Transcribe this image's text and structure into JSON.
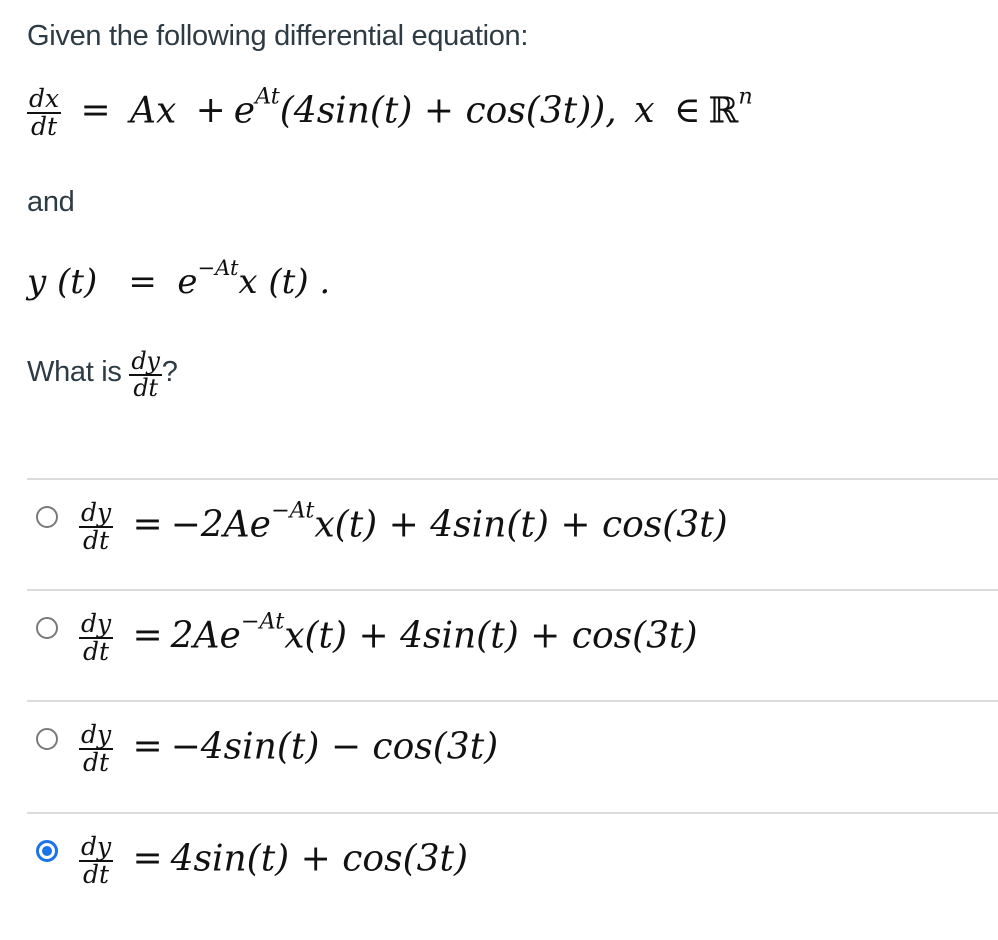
{
  "question": {
    "intro": "Given the following differential equation:",
    "equation1": {
      "lhs_num": "dx",
      "lhs_den": "dt",
      "equals": "=",
      "term1": "Ax",
      "plus": "+",
      "exp_base": "e",
      "exp_power": "At",
      "paren_content": "(4sin(t) + cos(3t)),",
      "domain_var": "x",
      "in_symbol": "∈",
      "set": "ℝ",
      "set_power": "n"
    },
    "connector": "and",
    "equation2": {
      "lhs": "y (t)",
      "equals": "=",
      "exp_base": "e",
      "exp_power": "−At",
      "rhs": "x (t) ."
    },
    "prompt_prefix": "What is",
    "prompt_num": "dy",
    "prompt_den": "dt",
    "prompt_suffix": "?"
  },
  "answers": [
    {
      "num": "dy",
      "den": "dt",
      "equals": "=",
      "pre": "−2Ae",
      "power": "−At",
      "post": "x(t) + 4sin(t) + cos(3t)",
      "selected": false
    },
    {
      "num": "dy",
      "den": "dt",
      "equals": "=",
      "pre": "2Ae",
      "power": "−At",
      "post": "x(t) + 4sin(t) + cos(3t)",
      "selected": false
    },
    {
      "num": "dy",
      "den": "dt",
      "equals": "=",
      "pre": "−4sin(t) − cos(3t)",
      "power": "",
      "post": "",
      "selected": false
    },
    {
      "num": "dy",
      "den": "dt",
      "equals": "=",
      "pre": "4sin(t) + cos(3t)",
      "power": "",
      "post": "",
      "selected": true
    }
  ],
  "colors": {
    "text": "#2d3b45",
    "math": "#111111",
    "radio_selected": "#1a73e8",
    "radio_unselected": "#7a7a7a",
    "divider": "#dcdcdc"
  }
}
